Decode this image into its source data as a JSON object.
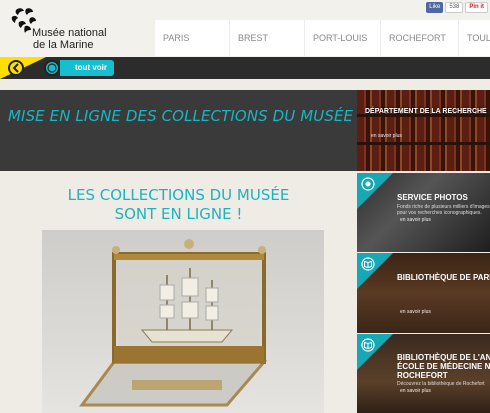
{
  "header": {
    "logo_line1": "Musée national",
    "logo_line2": "de la Marine",
    "nav": [
      {
        "label": "PARIS"
      },
      {
        "label": "BREST"
      },
      {
        "label": "PORT-LOUIS"
      },
      {
        "label": "ROCHEFORT"
      },
      {
        "label": "TOULON"
      }
    ],
    "social": {
      "like": "Like",
      "count": "538",
      "pin": "Pin it"
    }
  },
  "bar": {
    "back_icon": "back-arrow-icon",
    "compass_icon": "compass-icon",
    "tout_voir": "tout voir"
  },
  "banner": {
    "title": "MISE EN LIGNE DES COLLECTIONS DU MUSÉE"
  },
  "recherche_card": {
    "title": "DÉPARTEMENT DE LA RECHERCHE",
    "more": "en savoir plus"
  },
  "collections": {
    "title_line1": "LES COLLECTIONS DU MUSÉE",
    "title_line2": "SONT EN LIGNE !"
  },
  "side_cards": [
    {
      "icon": "camera-icon",
      "title": "SERVICE PHOTOS",
      "desc_line1": "Fonds riche de plusieurs milliers d'images",
      "desc_line2": "pour vos recherches iconographiques.",
      "more": "en savoir plus"
    },
    {
      "icon": "book-icon",
      "title": "BIBLIOTHÈQUE DE PARIS",
      "more": "en savoir plus"
    },
    {
      "icon": "book-icon",
      "title_line1": "BIBLIOTHÈQUE DE L'ANCIENNE",
      "title_line2": "ÉCOLE DE MÉDECINE NAVALE",
      "title_line3": "ROCHEFORT",
      "desc_line1": "Découvrez la bibliothèque de Rochefort",
      "more": "en savoir plus"
    }
  ],
  "colors": {
    "accent": "#17b6c4",
    "yellow": "#ffe000",
    "dark": "#2c2c2c"
  }
}
